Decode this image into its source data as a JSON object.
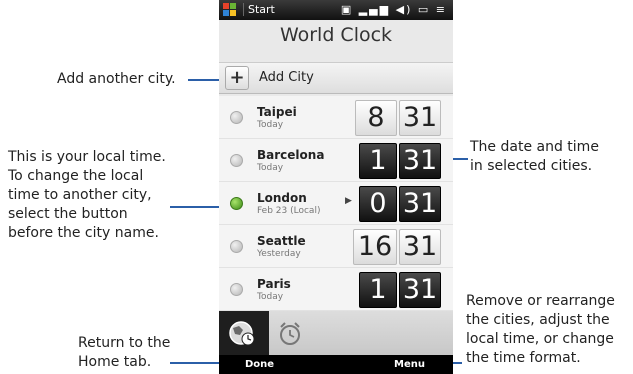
{
  "phone": {
    "status_bar": {
      "start_label": "Start"
    },
    "title": "World Clock",
    "add_city_label": "Add City",
    "cities": [
      {
        "name": "Taipei",
        "day": "Today",
        "hour": "8",
        "minute": "31",
        "selected": false,
        "tile_style": "light"
      },
      {
        "name": "Barcelona",
        "day": "Today",
        "hour": "1",
        "minute": "31",
        "selected": false,
        "tile_style": "dark"
      },
      {
        "name": "London",
        "day": "Feb 23  (Local)",
        "hour": "0",
        "minute": "31",
        "selected": true,
        "tile_style": "dark"
      },
      {
        "name": "Seattle",
        "day": "Yesterday",
        "hour": "16",
        "minute": "31",
        "selected": false,
        "tile_style": "light"
      },
      {
        "name": "Paris",
        "day": "Today",
        "hour": "1",
        "minute": "31",
        "selected": false,
        "tile_style": "dark"
      }
    ],
    "softkeys": {
      "left": "Done",
      "right": "Menu"
    }
  },
  "callouts": {
    "add_city": "Add another city.",
    "local_time": "This is your local time.\nTo change the local\ntime to another city,\nselect the button\nbefore the city name.",
    "date_time": "The date and time\nin selected cities.",
    "home_tab": "Return to the\nHome tab.",
    "menu": "Remove or rearrange\nthe cities, adjust the\nlocal time, or change\nthe time format."
  },
  "colors": {
    "callout_line": "#2b5fa8",
    "selected_radio": "#3c8a15"
  }
}
